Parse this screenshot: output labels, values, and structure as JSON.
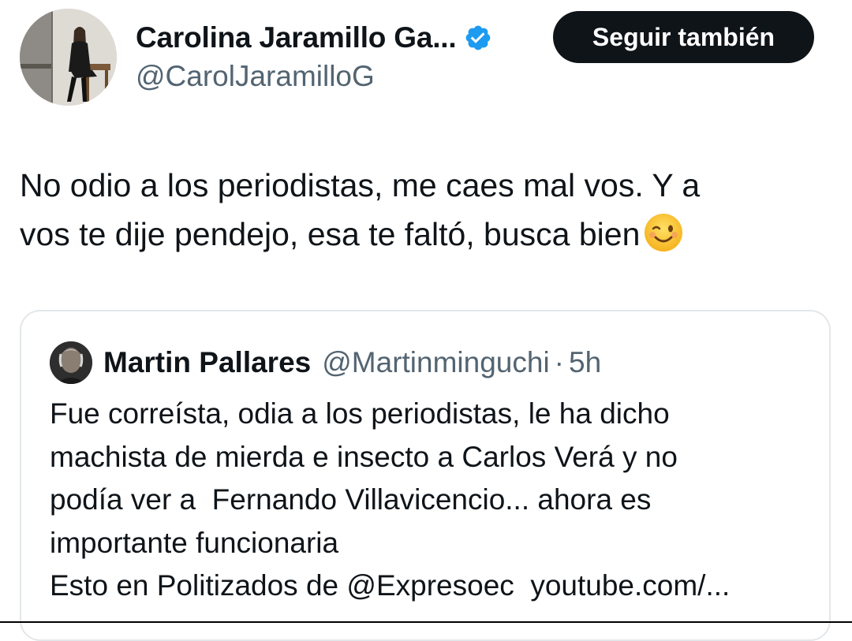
{
  "author": {
    "display_name": "Carolina Jaramillo Ga...",
    "handle": "@CarolJaramilloG",
    "verified_icon": "verified-badge-icon",
    "avatar": "profile-photo"
  },
  "follow_button": {
    "label": "Seguir también"
  },
  "tweet": {
    "text": "No odio a los periodistas, me caes mal vos. Y a\nvos te dije pendejo, esa te faltó, busca bien",
    "emoji": "winking-face-emoji"
  },
  "quoted_tweet": {
    "author_name": "Martin Pallares",
    "author_handle": "@Martinminguchi",
    "separator": "·",
    "time": "5h",
    "lines": [
      "Fue correísta, odia a los periodistas, le ha dicho",
      "machista de mierda e insecto a Carlos Verá y no",
      "podía ver a  Fernando Villavicencio... ahora es",
      "importante funcionaria",
      "Esto en Politizados de @Expresoec  youtube.com/..."
    ]
  },
  "colors": {
    "text_primary": "#0f1419",
    "text_secondary": "#536471",
    "verified_blue": "#1d9bf0",
    "button_bg": "#0f1419",
    "button_text": "#ffffff",
    "card_border": "#e3e7ea"
  }
}
